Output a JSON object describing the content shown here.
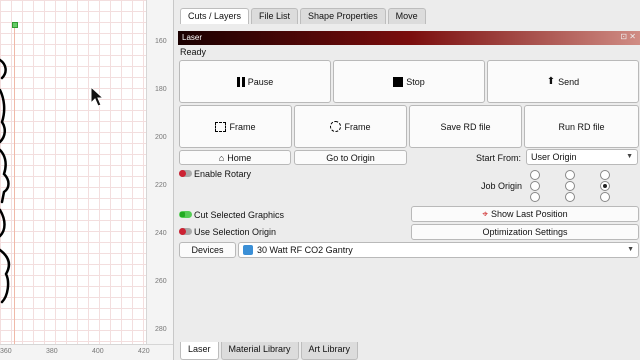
{
  "canvas": {
    "v_ticks": [
      "160",
      "180",
      "200",
      "220",
      "240",
      "260",
      "280"
    ],
    "h_ticks": [
      "360",
      "380",
      "400",
      "420"
    ]
  },
  "tabs_top": [
    "Cuts / Layers",
    "File List",
    "Shape Properties",
    "Move"
  ],
  "laser": {
    "title": "Laser",
    "status": "Ready",
    "pause": "Pause",
    "stop": "Stop",
    "send": "Send",
    "frame_rect": "Frame",
    "frame_circle": "Frame",
    "save_rd": "Save RD file",
    "run_rd": "Run RD file",
    "home": "Home",
    "go_origin": "Go to Origin",
    "start_from_label": "Start From:",
    "start_from_value": "User Origin",
    "enable_rotary": "Enable Rotary",
    "job_origin_label": "Job Origin",
    "cut_selected": "Cut Selected Graphics",
    "use_selection_origin": "Use Selection Origin",
    "show_last_position": "Show Last Position",
    "optimization_settings": "Optimization Settings",
    "devices": "Devices",
    "device_value": "30 Watt RF CO2 Gantry"
  },
  "tabs_bottom": [
    "Laser",
    "Material Library",
    "Art Library"
  ],
  "icons": {
    "pause": "pause-icon",
    "stop": "stop-icon",
    "send": "upload-icon",
    "frame_rect": "frame-rect-icon",
    "frame_circle": "frame-circle-icon",
    "home": "home-icon",
    "show_last": "crosshair-icon",
    "device": "device-icon"
  },
  "colors": {
    "header_start": "#1a0000",
    "header_mid": "#7a0d0d",
    "header_end": "#d08c84",
    "toggle_on": "#5c5",
    "toggle_off_knob": "#c23"
  }
}
